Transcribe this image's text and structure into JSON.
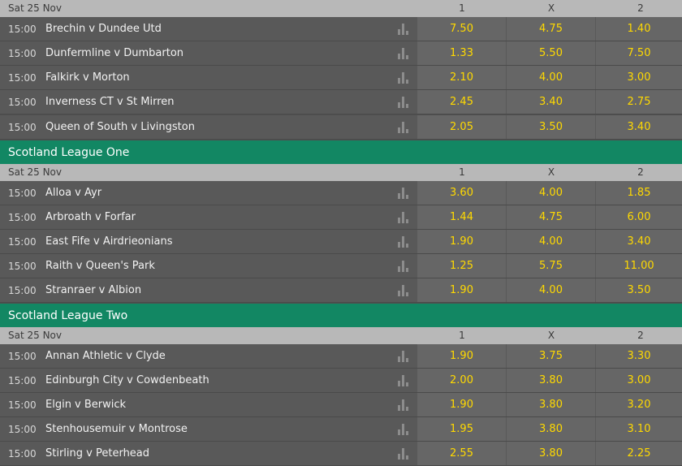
{
  "sections": [
    {
      "league": "",
      "date": "Sat 25 Nov",
      "col_labels": [
        "1",
        "X",
        "2"
      ],
      "events": [
        {
          "time": "15:00",
          "teams": "Brechin v Dundee Utd",
          "odds": [
            "7.50",
            "4.75",
            "1.40"
          ]
        },
        {
          "time": "15:00",
          "teams": "Dunfermline v Dumbarton",
          "odds": [
            "1.33",
            "5.50",
            "7.50"
          ]
        },
        {
          "time": "15:00",
          "teams": "Falkirk v Morton",
          "odds": [
            "2.10",
            "4.00",
            "3.00"
          ]
        },
        {
          "time": "15:00",
          "teams": "Inverness CT v St Mirren",
          "odds": [
            "2.45",
            "3.40",
            "2.75"
          ]
        },
        {
          "time": "15:00",
          "teams": "Queen of South v Livingston",
          "odds": [
            "2.05",
            "3.50",
            "3.40"
          ]
        }
      ]
    },
    {
      "league": "Scotland League One",
      "date": "Sat 25 Nov",
      "col_labels": [
        "1",
        "X",
        "2"
      ],
      "events": [
        {
          "time": "15:00",
          "teams": "Alloa v Ayr",
          "odds": [
            "3.60",
            "4.00",
            "1.85"
          ]
        },
        {
          "time": "15:00",
          "teams": "Arbroath v Forfar",
          "odds": [
            "1.44",
            "4.75",
            "6.00"
          ]
        },
        {
          "time": "15:00",
          "teams": "East Fife v Airdrieonians",
          "odds": [
            "1.90",
            "4.00",
            "3.40"
          ]
        },
        {
          "time": "15:00",
          "teams": "Raith v Queen's Park",
          "odds": [
            "1.25",
            "5.75",
            "11.00"
          ]
        },
        {
          "time": "15:00",
          "teams": "Stranraer v Albion",
          "odds": [
            "1.90",
            "4.00",
            "3.50"
          ]
        }
      ]
    },
    {
      "league": "Scotland League Two",
      "date": "Sat 25 Nov",
      "col_labels": [
        "1",
        "X",
        "2"
      ],
      "events": [
        {
          "time": "15:00",
          "teams": "Annan Athletic v Clyde",
          "odds": [
            "1.90",
            "3.75",
            "3.30"
          ]
        },
        {
          "time": "15:00",
          "teams": "Edinburgh City v Cowdenbeath",
          "odds": [
            "2.00",
            "3.80",
            "3.00"
          ]
        },
        {
          "time": "15:00",
          "teams": "Elgin v Berwick",
          "odds": [
            "1.90",
            "3.80",
            "3.20"
          ]
        },
        {
          "time": "15:00",
          "teams": "Stenhousemuir v Montrose",
          "odds": [
            "1.95",
            "3.80",
            "3.10"
          ]
        },
        {
          "time": "15:00",
          "teams": "Stirling v Peterhead",
          "odds": [
            "2.55",
            "3.80",
            "2.25"
          ]
        }
      ]
    }
  ],
  "icons": {
    "stats": "bar-chart-icon"
  },
  "colors": {
    "league_header": "#128763",
    "odds_text": "#ffd900",
    "row_bg": "#595959",
    "odds_bg": "#666666",
    "date_bar": "#b8b8b8"
  }
}
